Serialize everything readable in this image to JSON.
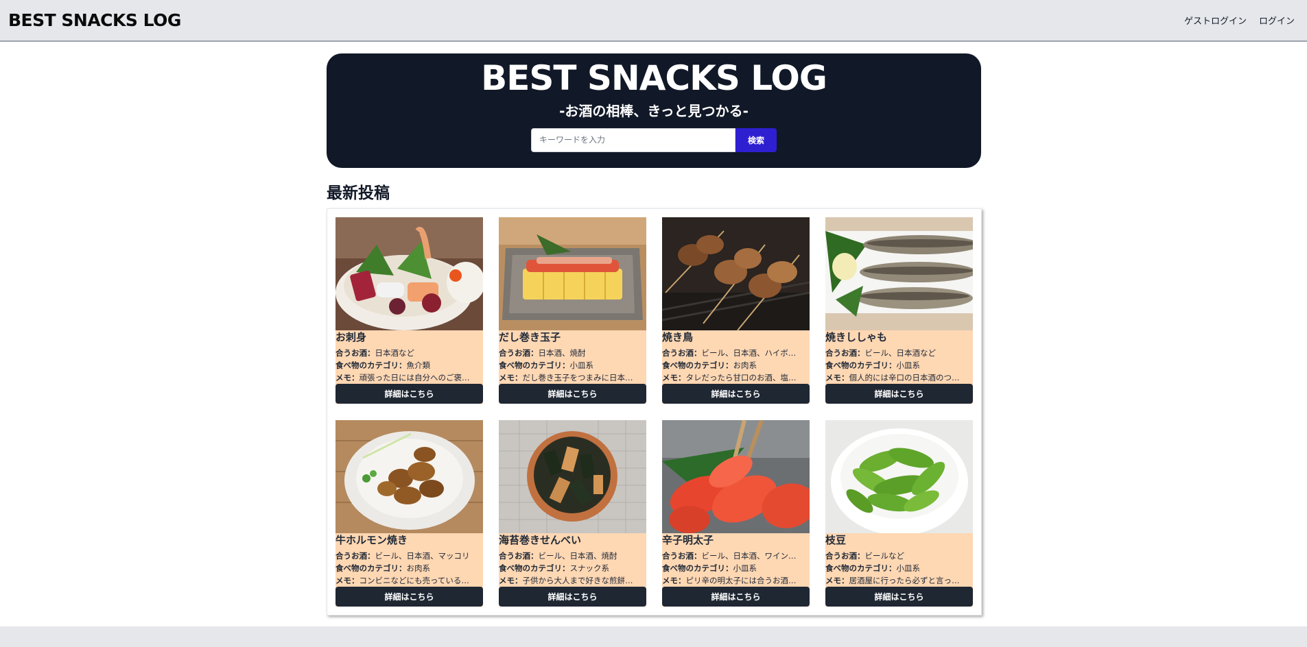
{
  "nav": {
    "brand": "BEST SNACKS LOG",
    "guest_login": "ゲストログイン",
    "login": "ログイン"
  },
  "hero": {
    "title": "BEST SNACKS LOG",
    "subtitle": "-お酒の相棒、きっと見つかる-",
    "search_placeholder": "キーワードを入力",
    "search_button": "検索"
  },
  "section_title": "最新投稿",
  "labels": {
    "drink": "合うお酒：",
    "category": "食べ物のカテゴリ：",
    "memo": "メモ：",
    "detail_button": "詳細はこちら"
  },
  "posts": [
    {
      "title": "お刺身",
      "drink": "日本酒など",
      "category": "魚介類",
      "memo": "頑張った日には自分へのご褒…",
      "image": "sashimi-photo"
    },
    {
      "title": "だし巻き玉子",
      "drink": "日本酒、焼酎",
      "category": "小皿系",
      "memo": "だし巻き玉子をつまみに日本…",
      "image": "dashimaki-photo"
    },
    {
      "title": "焼き鳥",
      "drink": "ビール、日本酒、ハイボ…",
      "category": "お肉系",
      "memo": "タレだったら甘口のお酒、塩…",
      "image": "yakitori-photo"
    },
    {
      "title": "焼きししゃも",
      "drink": "ビール、日本酒など",
      "category": "小皿系",
      "memo": "個人的には辛口の日本酒のつ…",
      "image": "shishamo-photo"
    },
    {
      "title": "牛ホルモン焼き",
      "drink": "ビール、日本酒、マッコリ",
      "category": "お肉系",
      "memo": "コンビニなどにも売っている…",
      "image": "horumon-photo"
    },
    {
      "title": "海苔巻きせんべい",
      "drink": "ビール、日本酒、焼酎",
      "category": "スナック系",
      "memo": "子供から大人まで好きな煎餅…",
      "image": "senbei-photo"
    },
    {
      "title": "辛子明太子",
      "drink": "ビール、日本酒、ワイン…",
      "category": "小皿系",
      "memo": "ピリ辛の明太子には合うお酒…",
      "image": "mentaiko-photo"
    },
    {
      "title": "枝豆",
      "drink": "ビールなど",
      "category": "小皿系",
      "memo": "居酒屋に行ったら必ずと言っ…",
      "image": "edamame-photo"
    }
  ]
}
